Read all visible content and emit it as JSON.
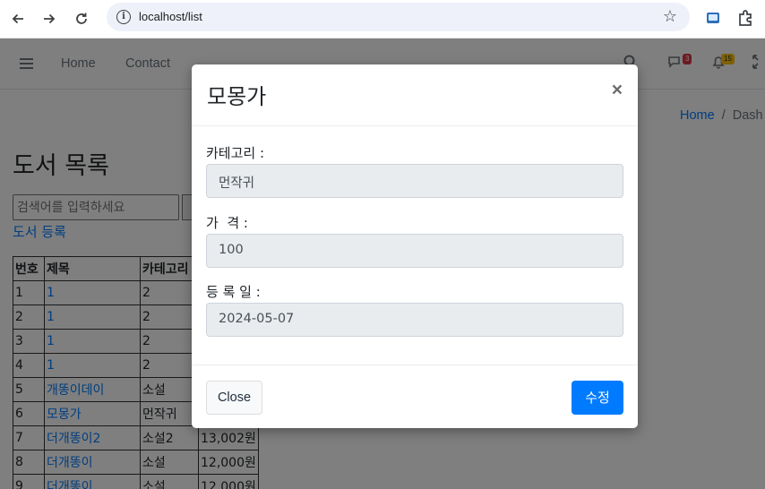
{
  "browser": {
    "url": "localhost/list"
  },
  "topnav": {
    "home": "Home",
    "contact": "Contact",
    "messages_badge": "3",
    "notifications_badge": "15"
  },
  "breadcrumb": {
    "home": "Home",
    "separator": "/",
    "current": "Dash"
  },
  "page": {
    "title": "도서 목록",
    "search_placeholder": "검색어를 입력하세요",
    "register_link": "도서 등록"
  },
  "table": {
    "headers": [
      "번호",
      "제목",
      "카테고리",
      ""
    ],
    "rows": [
      {
        "no": "1",
        "title": "1",
        "category": "2",
        "price": ""
      },
      {
        "no": "2",
        "title": "1",
        "category": "2",
        "price": ""
      },
      {
        "no": "3",
        "title": "1",
        "category": "2",
        "price": ""
      },
      {
        "no": "4",
        "title": "1",
        "category": "2",
        "price": ""
      },
      {
        "no": "5",
        "title": "개똥이데이",
        "category": "소설",
        "price": ""
      },
      {
        "no": "6",
        "title": "모몽가",
        "category": "먼작귀",
        "price": ""
      },
      {
        "no": "7",
        "title": "더개똥이2",
        "category": "소설2",
        "price": "13,002원"
      },
      {
        "no": "8",
        "title": "더개똥이",
        "category": "소설",
        "price": "12,000원"
      },
      {
        "no": "9",
        "title": "더개똥이",
        "category": "소설",
        "price": "12,000원"
      }
    ]
  },
  "modal": {
    "title": "모몽가",
    "close_symbol": "×",
    "fields": [
      {
        "label": "카테고리 :",
        "value": "먼작귀"
      },
      {
        "label": "가  격 :",
        "value": "100"
      },
      {
        "label": "등 록 일 :",
        "value": "2024-05-07"
      }
    ],
    "close_button": "Close",
    "edit_button": "수정"
  }
}
